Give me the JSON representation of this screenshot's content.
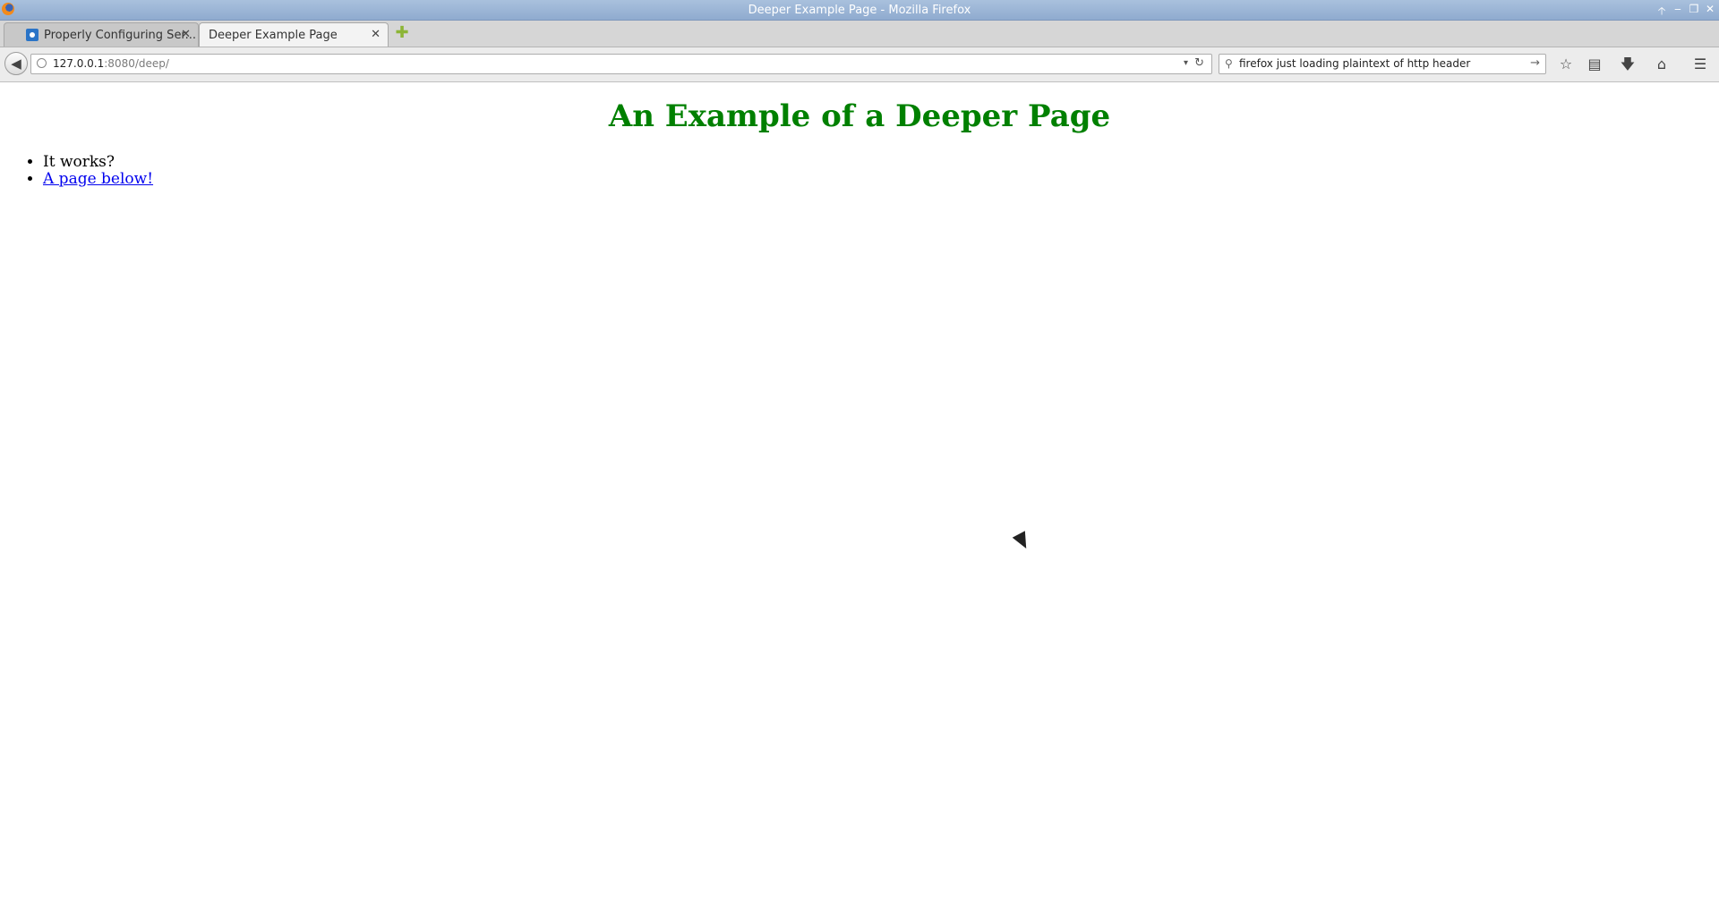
{
  "window": {
    "title": "Deeper Example Page - Mozilla Firefox",
    "controls": {
      "up": "🡡",
      "minimize": "‒",
      "maximize": "❐",
      "close": "✕"
    }
  },
  "tabs": [
    {
      "label": "Properly Configuring Ser...",
      "icon": "site-favicon",
      "active": false,
      "close": "✕"
    },
    {
      "label": "Deeper Example Page",
      "active": true,
      "close": "✕"
    }
  ],
  "new_tab": "✚",
  "navbar": {
    "back": "◀",
    "url_host": "127.0.0.1",
    "url_path": ":8080/deep/",
    "url_dropdown": "▾",
    "reload": "↻",
    "search_query": "firefox just loading plaintext of http header",
    "search_icon": "⚲",
    "search_go": "→",
    "bookmark_star": "☆",
    "reading_list": "▤",
    "downloads": "🡇",
    "home": "⌂",
    "menu": "☰"
  },
  "page": {
    "heading": "An Example of a Deeper Page",
    "items": [
      {
        "text": "It works?",
        "link": false
      },
      {
        "text": "A page below!",
        "link": true
      }
    ]
  },
  "colors": {
    "heading": "#008000",
    "link": "#0000ee",
    "titlebar": "#a9c1dd"
  }
}
